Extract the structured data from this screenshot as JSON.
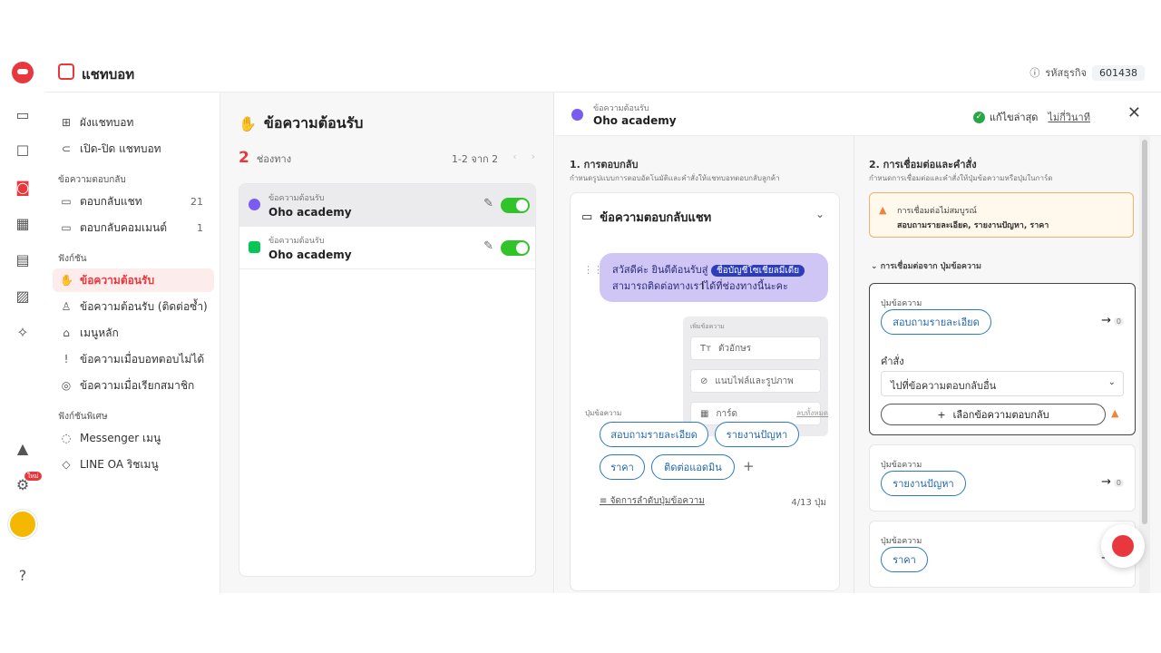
{
  "header": {
    "title": "แชทบอท",
    "biz_label": "รหัสธุรกิจ",
    "biz_code": "601438"
  },
  "menu": {
    "items_top": [
      {
        "label": "ผังแชทบอท"
      },
      {
        "label": "เปิด-ปิด แชทบอท"
      }
    ],
    "section1": "ข้อความตอบกลับ",
    "items_reply": [
      {
        "label": "ตอบกลับแชท",
        "count": "21"
      },
      {
        "label": "ตอบกลับคอมเมนต์",
        "count": "1"
      }
    ],
    "section2": "ฟังก์ชัน",
    "items_func": [
      {
        "label": "ข้อความต้อนรับ"
      },
      {
        "label": "ข้อความต้อนรับ (ติดต่อซ้ำ)"
      },
      {
        "label": "เมนูหลัก"
      },
      {
        "label": "ข้อความเมื่อบอทตอบไม่ได้"
      },
      {
        "label": "ข้อความเมื่อเรียกสมาชิก"
      }
    ],
    "section3": "ฟังก์ชันพิเศษ",
    "items_special": [
      {
        "label": "Messenger เมนู"
      },
      {
        "label": "LINE OA ริชเมนู"
      }
    ]
  },
  "list": {
    "title": "ข้อความต้อนรับ",
    "count": "2",
    "count_label": "ช่องทาง",
    "pager": "1-2 จาก 2",
    "rows": [
      {
        "sub": "ข้อความต้อนรับ",
        "name": "Oho academy",
        "channel": "messenger"
      },
      {
        "sub": "ข้อความต้อนรับ",
        "name": "Oho academy",
        "channel": "line"
      }
    ]
  },
  "detail": {
    "sub": "ข้อความต้อนรับ",
    "name": "Oho academy",
    "saved": "แก้ไขล่าสุด",
    "saved_link": "ไม่กี่วินาที",
    "sec1_title": "1. การตอบกลับ",
    "sec1_desc": "กำหนดรูปแบบการตอบอัตโนมัติและคำสั่งให้แชทบอทตอบกลับลูกค้า",
    "card_title": "ข้อความตอบกลับแชท",
    "bubble_prefix": "สวัสดีค่ะ ยินดีต้อนรับสู่",
    "bubble_tag": "ชื่อบัญชีโซเชียลมีเดีย",
    "bubble_line2": "สามารถติดต่อทางเราได้ที่ช่องทางนี้นะคะ",
    "insert_label": "เพิ่มข้อความ",
    "insert_items": [
      "ตัวอักษร",
      "แนบไฟล์และรูปภาพ",
      "การ์ด"
    ],
    "buttons_label": "ปุ่มข้อความ",
    "buttons_edit": "ลบทั้งหมด",
    "buttons": [
      "สอบถามรายละเอียด",
      "รายงานปัญหา",
      "ราคา",
      "ติดต่อแอดมิน"
    ],
    "manage": "จัดการลำดับปุ่มข้อความ",
    "btn_count": "4/13 ปุ่ม",
    "sec2_title": "2. การเชื่อมต่อและคำสั่ง",
    "sec2_desc": "กำหนดการเชื่อมต่อและคำสั่งให้ปุ่มข้อความหรือปุ่มในการ์ด",
    "warn_t1": "การเชื่อมต่อไม่สมบูรณ์",
    "warn_t2": "สอบถามรายละเอียด, รายงานปัญหา, ราคา",
    "from_label": "การเชื่อมต่อจาก ปุ่มข้อความ",
    "conn": [
      {
        "label": "ปุ่มข้อความ",
        "btn": "สอบถามรายละเอียด",
        "n": "0"
      },
      {
        "label": "ปุ่มข้อความ",
        "btn": "รายงานปัญหา",
        "n": "0"
      },
      {
        "label": "ปุ่มข้อความ",
        "btn": "ราคา",
        "n": "0"
      }
    ],
    "cmd_label": "คำสั่ง",
    "cmd_value": "ไปที่ข้อความตอบกลับอื่น",
    "add_label": "เลือกข้อความตอบกลับ"
  }
}
